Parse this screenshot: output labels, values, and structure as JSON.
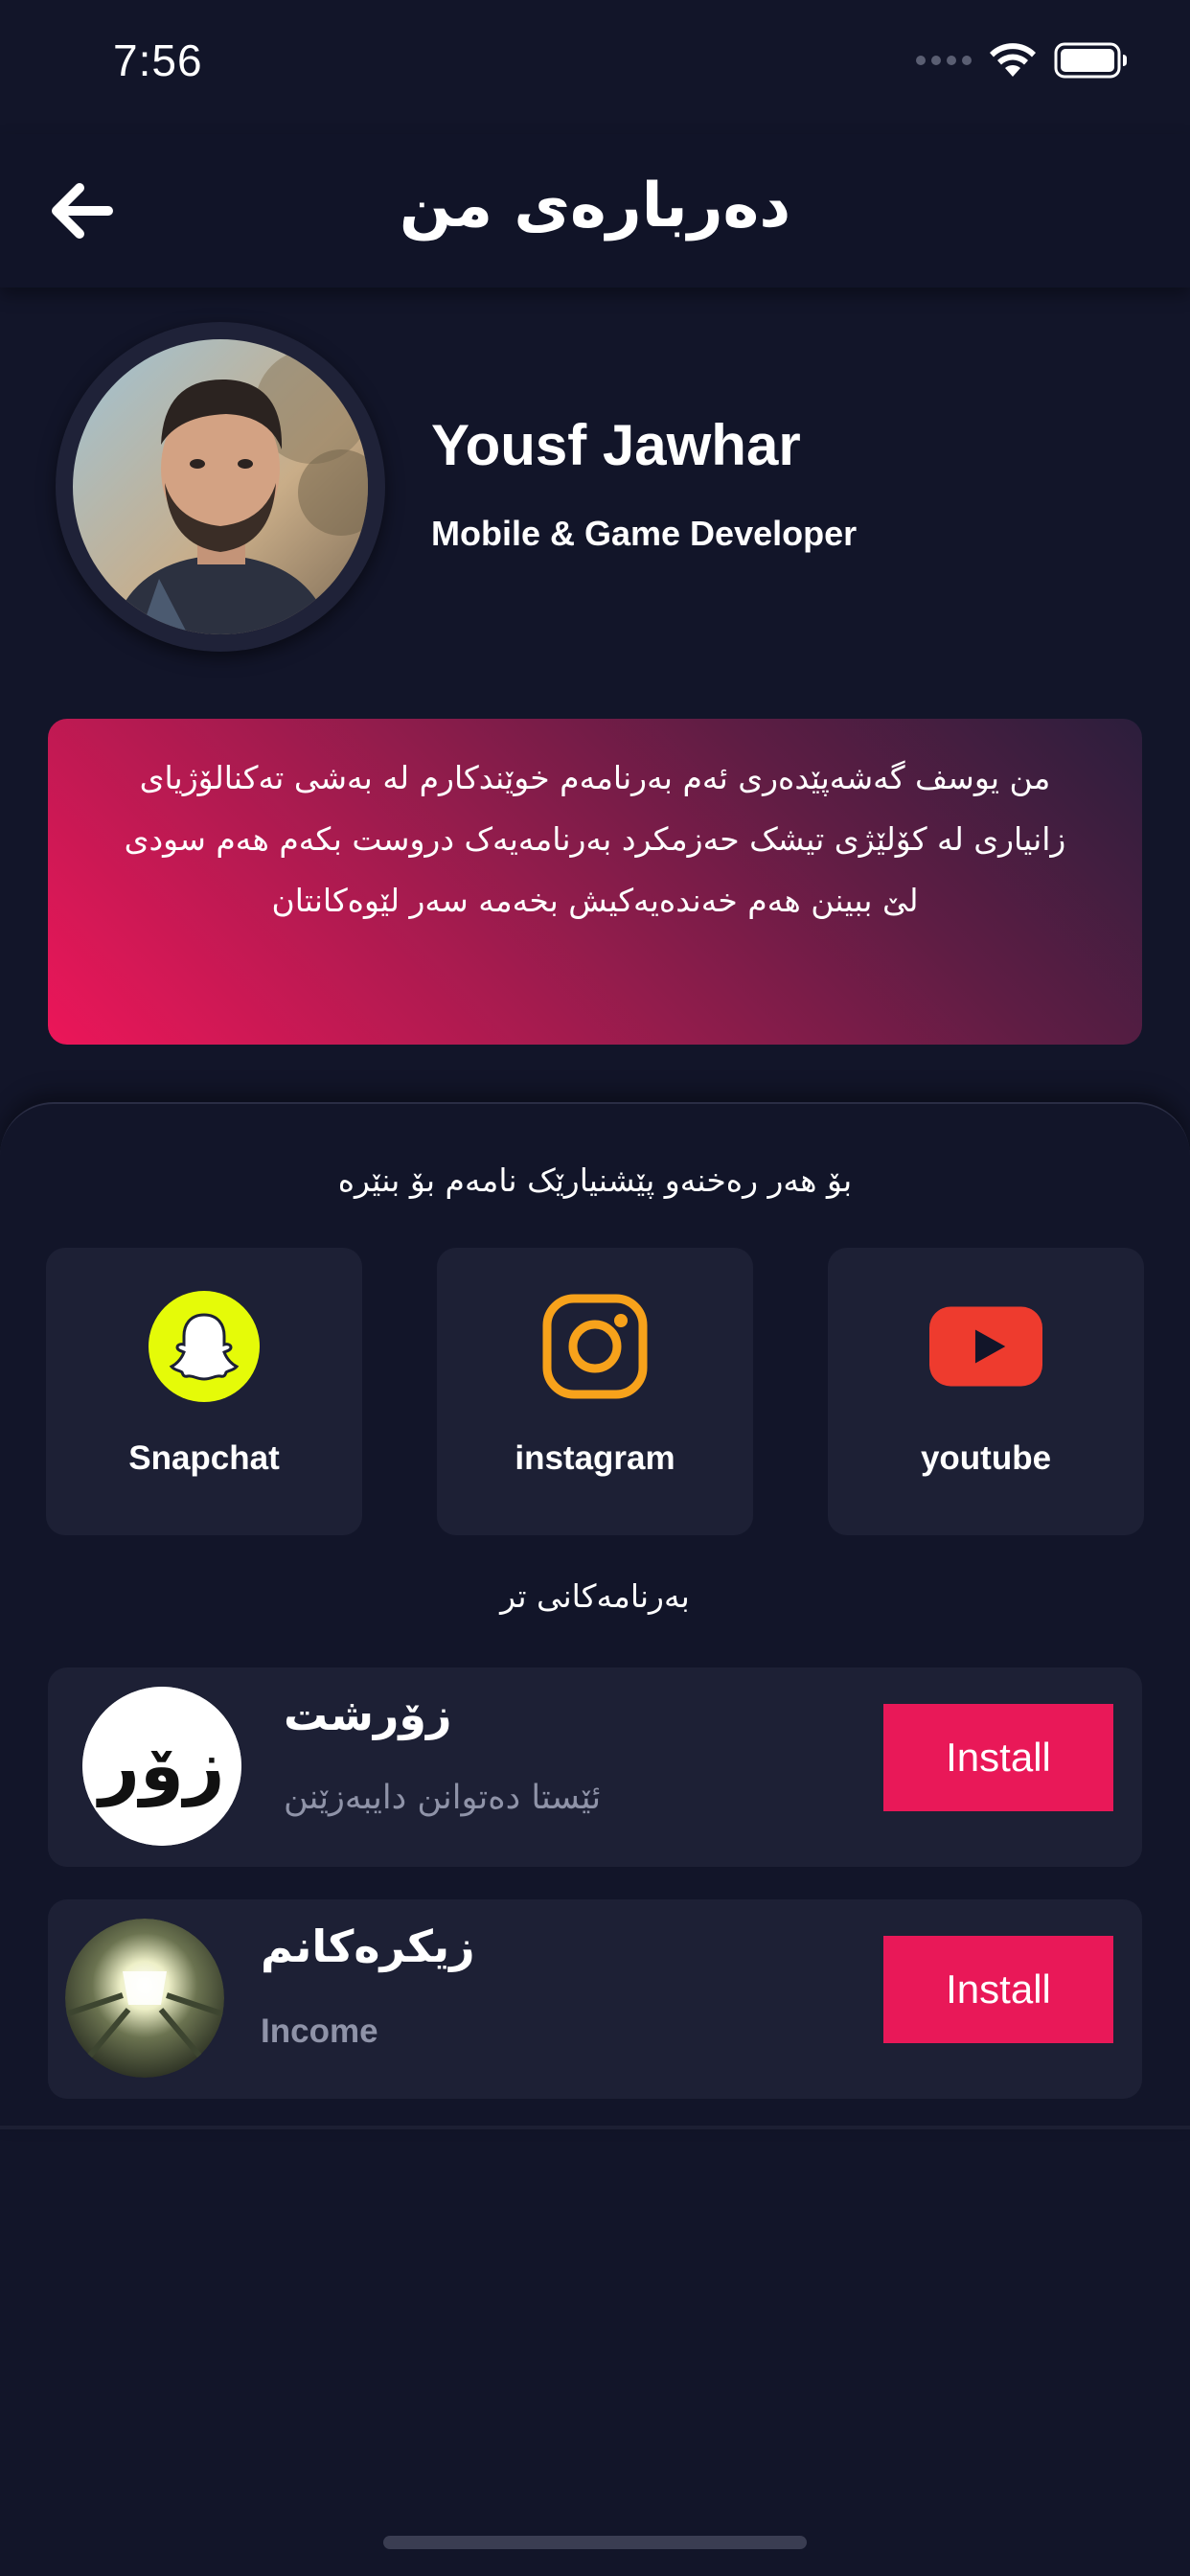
{
  "status_bar": {
    "time": "7:56"
  },
  "nav": {
    "title": "دەربارەی من",
    "back_icon": "arrow-left-icon"
  },
  "profile": {
    "name": "Yousf Jawhar",
    "role": "Mobile & Game Developer"
  },
  "bio": {
    "lines": [
      "من یوسف گەشەپێدەری ئەم بەرنامەم خوێندکارم لە بەشی تەکنالۆژیای",
      "زانیاری لە کۆلێژی تیشک حەزمکرد بەرنامەیەک دروست بکەم هەم سودی",
      "لێ ببینن هەم خەندەیەکیش بخەمە سەر لێوەکانتان"
    ]
  },
  "contact": {
    "title": "بۆ هەر رەخنەو پێشنیارێک نامەم بۆ بنێرە",
    "socials": [
      {
        "label": "youtube",
        "icon": "youtube-icon",
        "color": "#ee3b2e"
      },
      {
        "label": "instagram",
        "icon": "instagram-icon",
        "color": "#f7a21b"
      },
      {
        "label": "Snapchat",
        "icon": "snapchat-icon",
        "color": "#e5fb08"
      }
    ]
  },
  "other_apps": {
    "title": "بەرنامەکانی تر",
    "apps": [
      {
        "name": "زۆرشت",
        "subtitle": "ئێستا دەتوانن دایبەزێنن",
        "icon": "zorsht-app-icon",
        "icon_text": "زۆر",
        "button": "Install"
      },
      {
        "name": "زیکرەکانم",
        "subtitle": "Income",
        "icon": "zikr-app-icon",
        "button": "Install"
      }
    ]
  },
  "colors": {
    "background": "#121529",
    "card": "#1d2035",
    "accent": "#e91858"
  }
}
